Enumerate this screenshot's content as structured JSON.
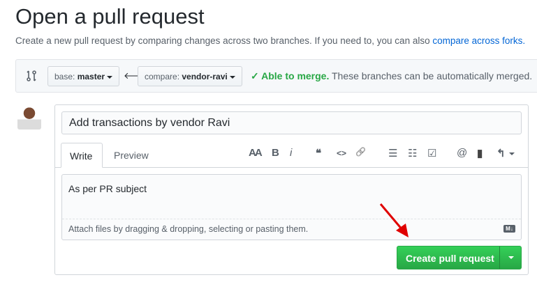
{
  "header": {
    "title": "Open a pull request",
    "subtitle": "Create a new pull request by comparing changes across two branches. If you need to, you can also ",
    "subtitle_link": "compare across forks."
  },
  "range": {
    "base_prefix": "base: ",
    "base": "master",
    "compare_prefix": "compare: ",
    "compare": "vendor-ravi",
    "status": "Able to merge.",
    "status_detail": " These branches can be automatically merged."
  },
  "form": {
    "title_value": "Add transactions by vendor Ravi",
    "tabs": [
      "Write",
      "Preview"
    ],
    "toolbar": {
      "heading": "AA",
      "bold": "B",
      "italic": "i",
      "quote": "❝",
      "code": "<>",
      "link": "🔗",
      "ul": "☰",
      "ol": "☷",
      "task": "☑",
      "mention": "@",
      "ref": "▮",
      "reply": "↰"
    },
    "body": "As per PR subject",
    "attach_hint": "Attach files by dragging & dropping, selecting or pasting them.",
    "markdown_badge": "M↓",
    "submit": "Create pull request"
  },
  "colors": {
    "accent": "#28a745",
    "link": "#0366d6",
    "annotation": "#e00000"
  }
}
